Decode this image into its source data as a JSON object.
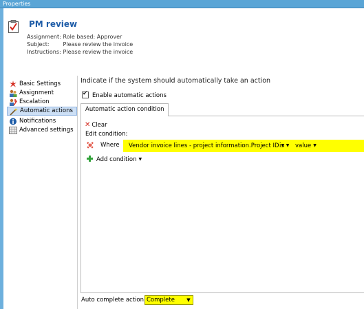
{
  "window": {
    "title": "Properties"
  },
  "header": {
    "title": "PM review",
    "rows": [
      {
        "label": "Assignment:",
        "value": "Role based: Approver"
      },
      {
        "label": "Subject:",
        "value": "Please review the invoice"
      },
      {
        "label": "Instructions:",
        "value": "Please review the invoice"
      }
    ]
  },
  "nav": {
    "items": [
      {
        "label": "Basic Settings",
        "icon": "red-star-icon",
        "selected": false
      },
      {
        "label": "Assignment",
        "icon": "people-icon",
        "selected": false
      },
      {
        "label": "Escalation",
        "icon": "escalation-icon",
        "selected": false
      },
      {
        "label": "Automatic actions",
        "icon": "wand-icon",
        "selected": true
      },
      {
        "label": "Notifications",
        "icon": "info-icon",
        "selected": false
      },
      {
        "label": "Advanced settings",
        "icon": "settings-grid-icon",
        "selected": false
      }
    ]
  },
  "panel": {
    "heading": "Indicate if the system should automatically take an action",
    "enable_checkbox": {
      "label": "Enable automatic actions",
      "checked": true
    },
    "tab_label": "Automatic action condition",
    "clear_label": "Clear",
    "edit_condition_label": "Edit condition:",
    "condition": {
      "where_label": "Where",
      "field": "Vendor invoice lines - project information.Project ID",
      "operator": "is",
      "value": "value"
    },
    "add_condition_label": "Add condition"
  },
  "footer": {
    "auto_complete_label": "Auto complete action:",
    "auto_complete_value": "Complete"
  },
  "colors": {
    "highlight": "#ffff00",
    "title": "#1f5da8",
    "titlebar": "#5aa5d6"
  }
}
